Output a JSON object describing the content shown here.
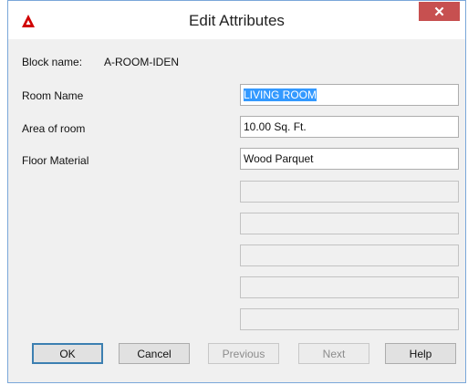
{
  "window": {
    "title": "Edit Attributes",
    "close_glyph": "✕"
  },
  "block": {
    "label": "Block name:",
    "value": "A-ROOM-IDEN"
  },
  "attributes": [
    {
      "label": "Room Name",
      "value": "LIVING ROOM",
      "selected": true
    },
    {
      "label": "Area of room",
      "value": "10.00 Sq. Ft."
    },
    {
      "label": "Floor Material",
      "value": "Wood Parquet"
    }
  ],
  "buttons": {
    "ok": "OK",
    "cancel": "Cancel",
    "previous": "Previous",
    "next": "Next",
    "help": "Help"
  },
  "colors": {
    "accent": "#3399ff",
    "close": "#c75050",
    "app_icon": "#d00000"
  },
  "icons": {
    "app": "autocad-logo-icon",
    "close": "close-icon"
  }
}
